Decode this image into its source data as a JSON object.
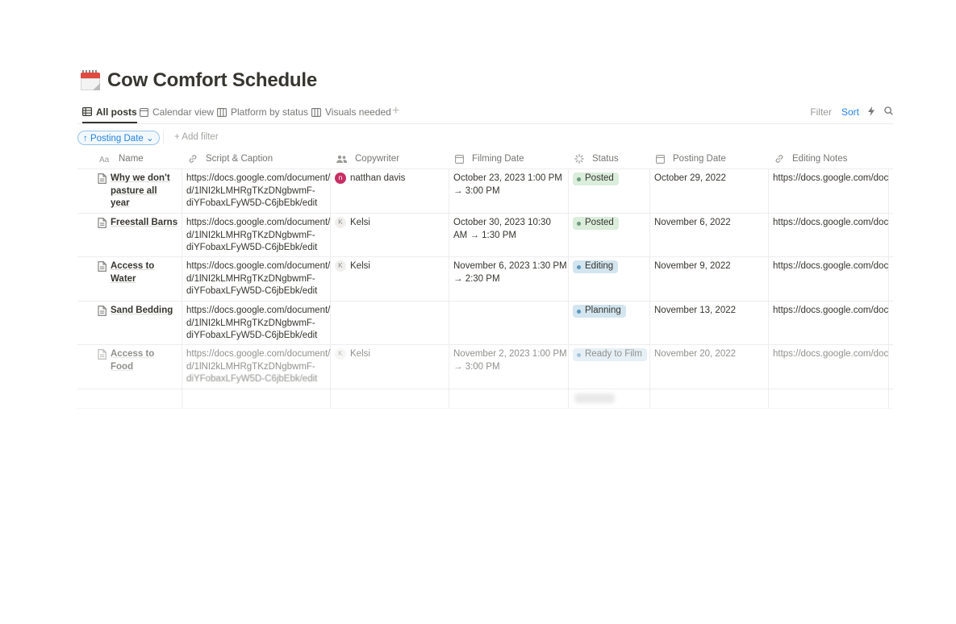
{
  "page": {
    "title": "Cow Comfort Schedule",
    "icon": "tear-off-calendar-icon"
  },
  "tabs": [
    {
      "label": "All posts",
      "icon": "table-icon",
      "active": true
    },
    {
      "label": "Calendar view",
      "icon": "calendar-icon",
      "active": false
    },
    {
      "label": "Platform by status",
      "icon": "board-icon",
      "active": false
    },
    {
      "label": "Visuals needed",
      "icon": "board-icon",
      "active": false
    }
  ],
  "toolbar": {
    "filter_label": "Filter",
    "sort_label": "Sort"
  },
  "filters": {
    "sort_pill": "↑ Posting Date ⌄",
    "add_filter": "+ Add filter"
  },
  "columns": [
    {
      "label": "Name",
      "icon": "text-aa-icon"
    },
    {
      "label": "Script & Caption",
      "icon": "link-icon"
    },
    {
      "label": "Copywriter",
      "icon": "people-icon"
    },
    {
      "label": "Filming Date",
      "icon": "calendar-icon"
    },
    {
      "label": "Status",
      "icon": "status-spinner-icon"
    },
    {
      "label": "Posting Date",
      "icon": "calendar-icon"
    },
    {
      "label": "Editing Notes",
      "icon": "link-icon"
    }
  ],
  "rows": [
    {
      "name_line1": "Why we don't",
      "name_line2": "pasture all year",
      "script_line1": "https://docs.google.com/document/",
      "script_line2": "d/1lNI2kLMHRgTKzDNgbwmF-",
      "script_line3": "diYFobaxLFyW5D-C6jbEbk/edit",
      "copywriter_initial": "n",
      "copywriter": "natthan davis",
      "filming_line1": "October 23, 2023 1:00 PM",
      "filming_line2": "→ 3:00 PM",
      "status": "Posted",
      "posting_date": "October 29, 2022",
      "editing_notes": "https://docs.google.com/docu"
    },
    {
      "name_line1": "Freestall Barns",
      "script_line1": "https://docs.google.com/document/",
      "script_line2": "d/1lNI2kLMHRgTKzDNgbwmF-",
      "script_line3": "diYFobaxLFyW5D-C6jbEbk/edit",
      "copywriter_initial": "K",
      "copywriter": "Kelsi",
      "filming_line1": "October 30, 2023 10:30",
      "filming_line2": "AM → 1:30 PM",
      "status": "Posted",
      "posting_date": "November 6, 2022",
      "editing_notes": "https://docs.google.com/docu"
    },
    {
      "name_line1": "Access to Water",
      "script_line1": "https://docs.google.com/document/",
      "script_line2": "d/1lNI2kLMHRgTKzDNgbwmF-",
      "script_line3": "diYFobaxLFyW5D-C6jbEbk/edit",
      "copywriter_initial": "K",
      "copywriter": "Kelsi",
      "filming_line1": "November 6, 2023 1:30 PM",
      "filming_line2": "→ 2:30 PM",
      "status": "Editing",
      "posting_date": "November 9, 2022",
      "editing_notes": "https://docs.google.com/docu"
    },
    {
      "name_line1": "Sand Bedding",
      "script_line1": "https://docs.google.com/document/",
      "script_line2": "d/1lNI2kLMHRgTKzDNgbwmF-",
      "script_line3": "diYFobaxLFyW5D-C6jbEbk/edit",
      "status": "Planning",
      "posting_date": "November 13, 2022",
      "editing_notes": "https://docs.google.com/docu"
    },
    {
      "name_line1": "Access to Food",
      "script_line1": "https://docs.google.com/document/",
      "script_line2": "d/1lNI2kLMHRgTKzDNgbwmF-",
      "script_line3": "diYFobaxLFyW5D-C6jbEbk/edit",
      "copywriter_initial": "K",
      "copywriter": "Kelsi",
      "filming_line1": "November 2, 2023 1:00 PM",
      "filming_line2": "→ 3:00 PM",
      "status": "Ready to Film",
      "posting_date": "November 20, 2022",
      "editing_notes": "https://docs.google.com/docu"
    }
  ],
  "status_colors": {
    "Posted": {
      "bg": "#dbeddb",
      "dot": "#6c9b7d"
    },
    "Editing": {
      "bg": "#d3e5ef",
      "dot": "#5b97bd"
    },
    "Planning": {
      "bg": "#d3e5ef",
      "dot": "#5b97bd"
    },
    "Ready to Film": {
      "bg": "#d3e5ef",
      "dot": "#5b97bd"
    }
  }
}
